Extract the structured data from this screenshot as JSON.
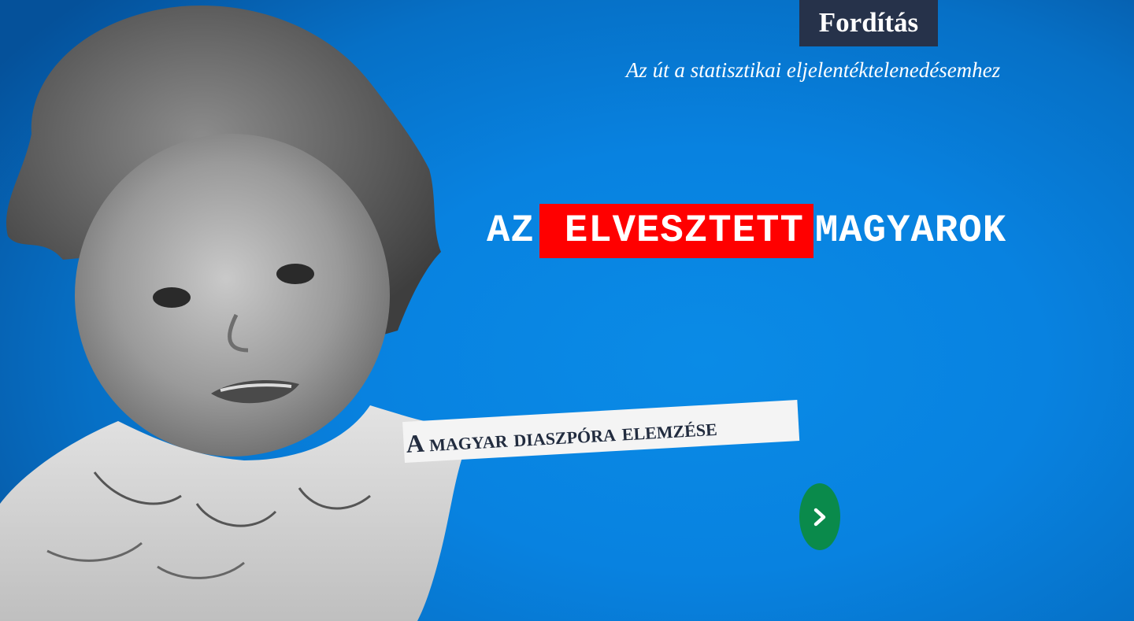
{
  "header": {
    "translate_label": "Fordítás",
    "subtitle": "Az út a statisztikai eljelentéktelenedésemhez"
  },
  "hero": {
    "headline_word1": "AZ",
    "headline_word2": "ELVESZTETT",
    "headline_word3": "MAGYAROK",
    "tagline": "A magyar diaszpóra elemzése",
    "next_icon": "chevron-right-icon"
  },
  "colors": {
    "background": "#0882e0",
    "translate_button": "#26324a",
    "highlight": "#ff0000",
    "next_button": "#0a8a4b",
    "tagline_background": "#f4f4f4",
    "tagline_text": "#222c3f"
  }
}
